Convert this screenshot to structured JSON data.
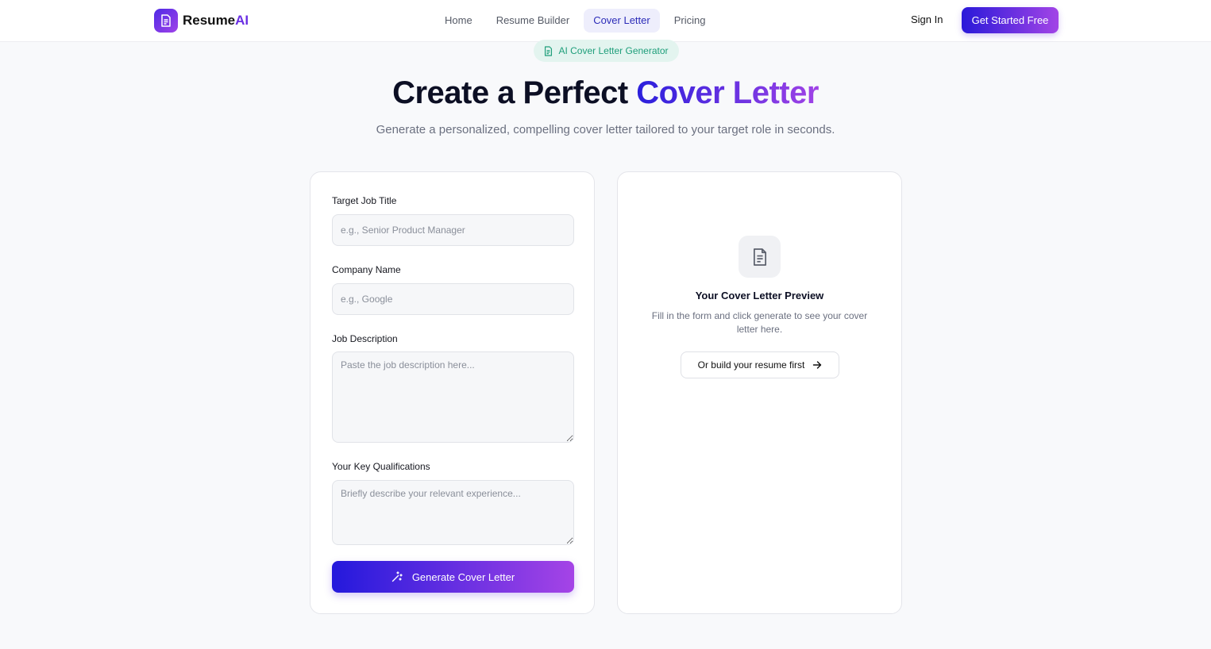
{
  "brand": {
    "name_main": "Resume",
    "name_accent": "AI"
  },
  "nav": {
    "items": [
      {
        "label": "Home",
        "active": false
      },
      {
        "label": "Resume Builder",
        "active": false
      },
      {
        "label": "Cover Letter",
        "active": true
      },
      {
        "label": "Pricing",
        "active": false
      }
    ],
    "signin": "Sign In",
    "cta": "Get Started Free"
  },
  "hero": {
    "badge": "AI Cover Letter Generator",
    "title_plain": "Create a Perfect ",
    "title_accent": "Cover Letter",
    "subtitle": "Generate a personalized, compelling cover letter tailored to your target role in seconds."
  },
  "form": {
    "job_title": {
      "label": "Target Job Title",
      "value": "",
      "placeholder": "e.g., Senior Product Manager"
    },
    "company": {
      "label": "Company Name",
      "value": "",
      "placeholder": "e.g., Google"
    },
    "description": {
      "label": "Job Description",
      "value": "",
      "placeholder": "Paste the job description here..."
    },
    "qualifications": {
      "label": "Your Key Qualifications",
      "value": "",
      "placeholder": "Briefly describe your relevant experience..."
    },
    "submit": "Generate Cover Letter"
  },
  "preview": {
    "title": "Your Cover Letter Preview",
    "text": "Fill in the form and click generate to see your cover letter here.",
    "link": "Or build your resume first"
  },
  "colors": {
    "accent_start": "#2a19d9",
    "accent_end": "#a244e6",
    "badge_bg": "#e3f4ef",
    "badge_text": "#1e9e7a"
  },
  "icons": {
    "logo": "document-icon",
    "badge": "document-icon",
    "generate": "magic-wand-icon",
    "preview": "document-icon",
    "link": "arrow-right-icon"
  }
}
